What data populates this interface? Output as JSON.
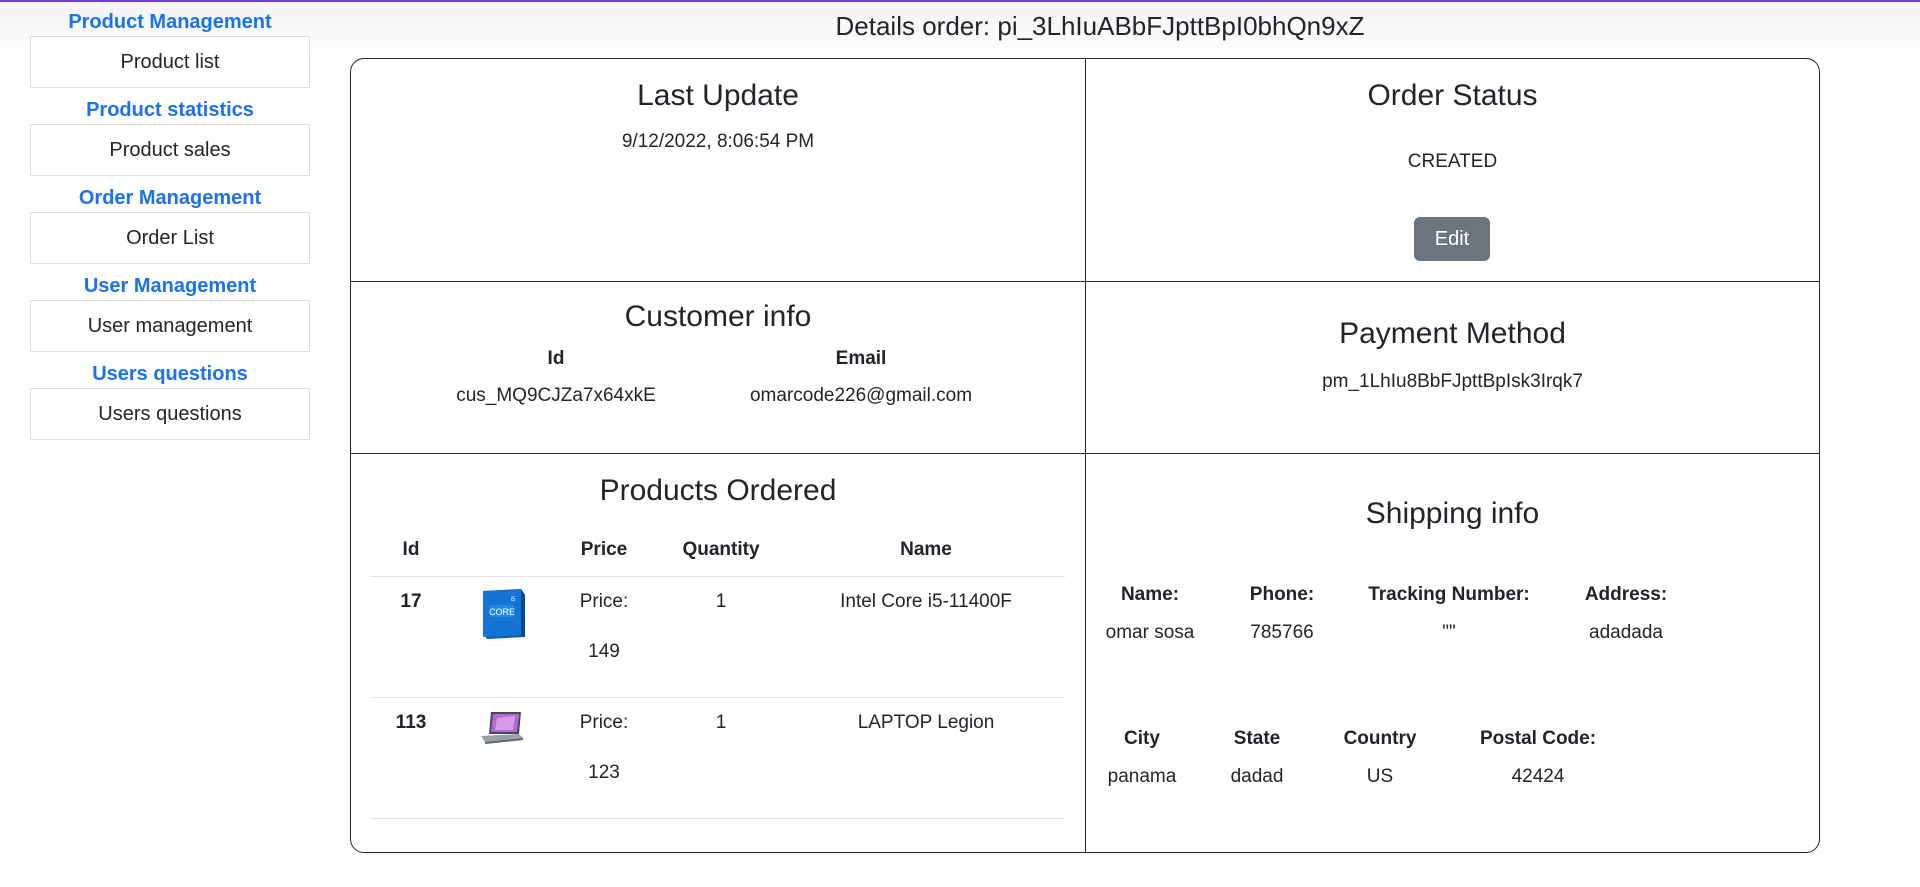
{
  "sidebar": {
    "sections": [
      {
        "title": "Product Management",
        "item": "Product list"
      },
      {
        "title": "Product statistics",
        "item": "Product sales"
      },
      {
        "title": "Order Management",
        "item": "Order List"
      },
      {
        "title": "User Management",
        "item": "User management"
      },
      {
        "title": "Users questions",
        "item": "Users questions"
      }
    ]
  },
  "page_title": "Details order: pi_3LhIuABbFJpttBpI0bhQn9xZ",
  "last_update": {
    "title": "Last Update",
    "value": "9/12/2022, 8:06:54 PM"
  },
  "order_status": {
    "title": "Order Status",
    "value": "CREATED",
    "edit_label": "Edit"
  },
  "customer": {
    "title": "Customer info",
    "id_label": "Id",
    "id_value": "cus_MQ9CJZa7x64xkE",
    "email_label": "Email",
    "email_value": "omarcode226@gmail.com"
  },
  "payment": {
    "title": "Payment Method",
    "value": "pm_1LhIu8BbFJpttBpIsk3Irqk7"
  },
  "products": {
    "title": "Products Ordered",
    "headers": [
      "Id",
      "",
      "Price",
      "Quantity",
      "Name"
    ],
    "rows": [
      {
        "id": "17",
        "image": "intel-core-cpu-box-icon",
        "price_label": "Price:",
        "price": "149",
        "quantity": "1",
        "name": "Intel Core i5-11400F"
      },
      {
        "id": "113",
        "image": "laptop-icon",
        "price_label": "Price:",
        "price": "123",
        "quantity": "1",
        "name": "LAPTOP Legion"
      }
    ]
  },
  "shipping": {
    "title": "Shipping info",
    "row1": [
      {
        "label": "Name:",
        "value": "omar sosa"
      },
      {
        "label": "Phone:",
        "value": "785766"
      },
      {
        "label": "Tracking Number:",
        "value": "\"\""
      },
      {
        "label": "Address:",
        "value": "adadada"
      }
    ],
    "row2": [
      {
        "label": "City",
        "value": "panama"
      },
      {
        "label": "State",
        "value": "dadad"
      },
      {
        "label": "Country",
        "value": "US"
      },
      {
        "label": "Postal Code:",
        "value": "42424"
      }
    ]
  },
  "colors": {
    "accent": "#1a73e8",
    "edit_button": "#6c757d",
    "top_bar": "#6f42c1"
  }
}
